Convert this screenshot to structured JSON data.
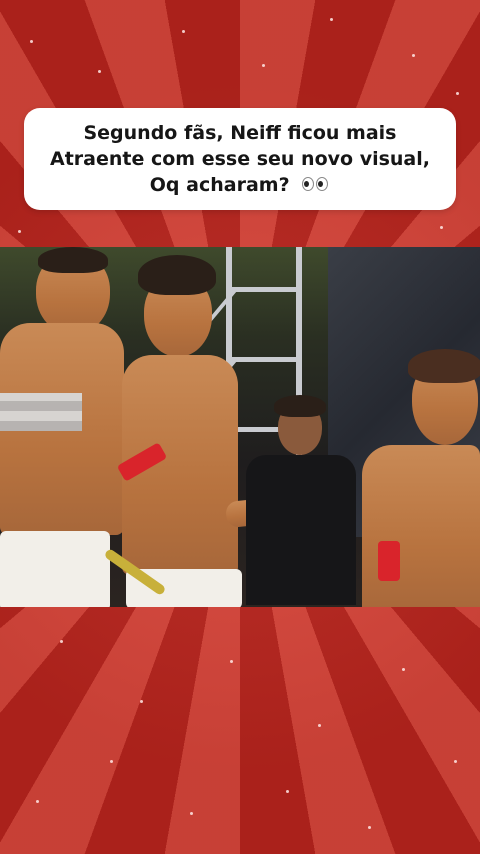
{
  "caption": {
    "line1": "Segundo fãs, Neiff ficou mais",
    "line2": "Atraente com esse seu novo visual,",
    "line3": "Oq acharam?",
    "emoji_icon": "eyes-emoji"
  },
  "colors": {
    "background_light_ray": "#d8453a",
    "background_dark_ray": "#b8241d",
    "caption_box": "#ffffff",
    "caption_text": "#161616"
  }
}
